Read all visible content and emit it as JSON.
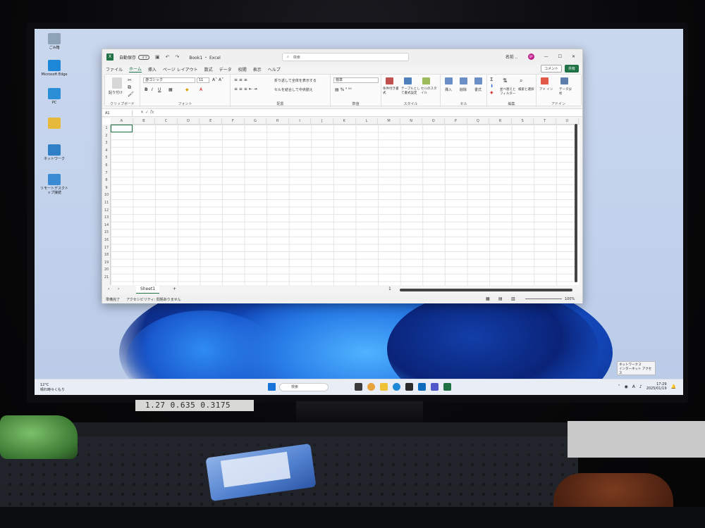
{
  "desktop": {
    "icons": [
      {
        "label": "ごみ箱",
        "color": "#8fa3b8"
      },
      {
        "label": "Microsoft Edge",
        "color": "#1e88d8"
      },
      {
        "label": "PC",
        "color": "#2a8fd6"
      },
      {
        "label": "",
        "color": "#e7b93b"
      },
      {
        "label": "ネットワーク",
        "color": "#2f7fc6"
      },
      {
        "label": "リモートデスクトップ接続",
        "color": "#3a8ad4"
      }
    ]
  },
  "excel": {
    "autosave_label": "自動保存",
    "autosave_state": "オフ",
    "title": "Book1 ・ Excel",
    "search_placeholder": "検索",
    "user_name": "名前 ..",
    "user_initials": "SP",
    "menus": [
      "ファイル",
      "ホーム",
      "挿入",
      "ページ レイアウト",
      "数式",
      "データ",
      "校閲",
      "表示",
      "ヘルプ"
    ],
    "active_menu": "ホーム",
    "comment_button": "コメント",
    "share_button": "共有",
    "ribbon": {
      "clipboard": {
        "label": "クリップボード",
        "paste": "貼り付け"
      },
      "font": {
        "label": "フォント",
        "font_name": "游ゴシック",
        "font_size": "11"
      },
      "alignment": {
        "label": "配置",
        "wrap_text": "折り返して全体を表示する",
        "merge_center": "セルを結合して中央揃え"
      },
      "number": {
        "label": "数値",
        "format": "標準"
      },
      "styles": {
        "label": "スタイル",
        "conditional": "条件付き書式",
        "table": "テーブルとして書式設定",
        "cell_styles": "セルのスタイル"
      },
      "cells": {
        "label": "セル",
        "insert": "挿入",
        "delete": "削除",
        "format": "書式"
      },
      "editing": {
        "label": "編集",
        "sort_filter": "並べ替えとフィルター",
        "find_select": "検索と選択"
      },
      "addins": {
        "label": "アドイン",
        "addins": "アド イン",
        "analyze": "データ分析"
      }
    },
    "name_box": "A1",
    "columns": [
      "A",
      "B",
      "C",
      "D",
      "E",
      "F",
      "G",
      "H",
      "I",
      "J",
      "K",
      "L",
      "M",
      "N",
      "O",
      "P",
      "Q",
      "R",
      "S",
      "T",
      "U"
    ],
    "rows": [
      "1",
      "2",
      "3",
      "4",
      "5",
      "6",
      "7",
      "8",
      "9",
      "10",
      "11",
      "12",
      "13",
      "14",
      "15",
      "16",
      "17",
      "18",
      "19",
      "20",
      "21"
    ],
    "sheet_tab": "Sheet1",
    "page_number": "1",
    "status_ready": "準備完了",
    "status_accessibility": "アクセシビリティ: 問題ありません",
    "zoom": "100%"
  },
  "taskbar": {
    "temperature": "12°C",
    "weather": "晴れ時々くもり",
    "search": "検索",
    "time": "17:29",
    "date": "2025/01/19",
    "ime": "A",
    "network_toast": [
      "ネットワーク 2",
      "インターネット アクセス"
    ]
  },
  "label_strip": "1.27  0.635  0.3175"
}
